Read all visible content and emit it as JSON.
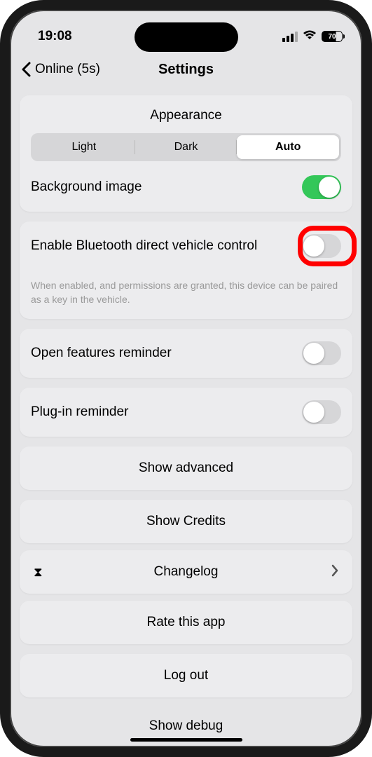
{
  "status": {
    "time": "19:08",
    "battery": "70"
  },
  "nav": {
    "back_label": "Online (5s)",
    "title": "Settings"
  },
  "appearance": {
    "title": "Appearance",
    "segments": {
      "light": "Light",
      "dark": "Dark",
      "auto": "Auto"
    },
    "bg_image_label": "Background image"
  },
  "bluetooth": {
    "label": "Enable Bluetooth direct vehicle control",
    "help": "When enabled, and permissions are granted, this device can be paired as a key in the vehicle."
  },
  "open_features": {
    "label": "Open features reminder"
  },
  "plugin": {
    "label": "Plug-in reminder"
  },
  "buttons": {
    "show_advanced": "Show advanced",
    "show_credits": "Show Credits",
    "changelog": "Changelog",
    "rate": "Rate this app",
    "logout": "Log out",
    "debug": "Show debug"
  }
}
